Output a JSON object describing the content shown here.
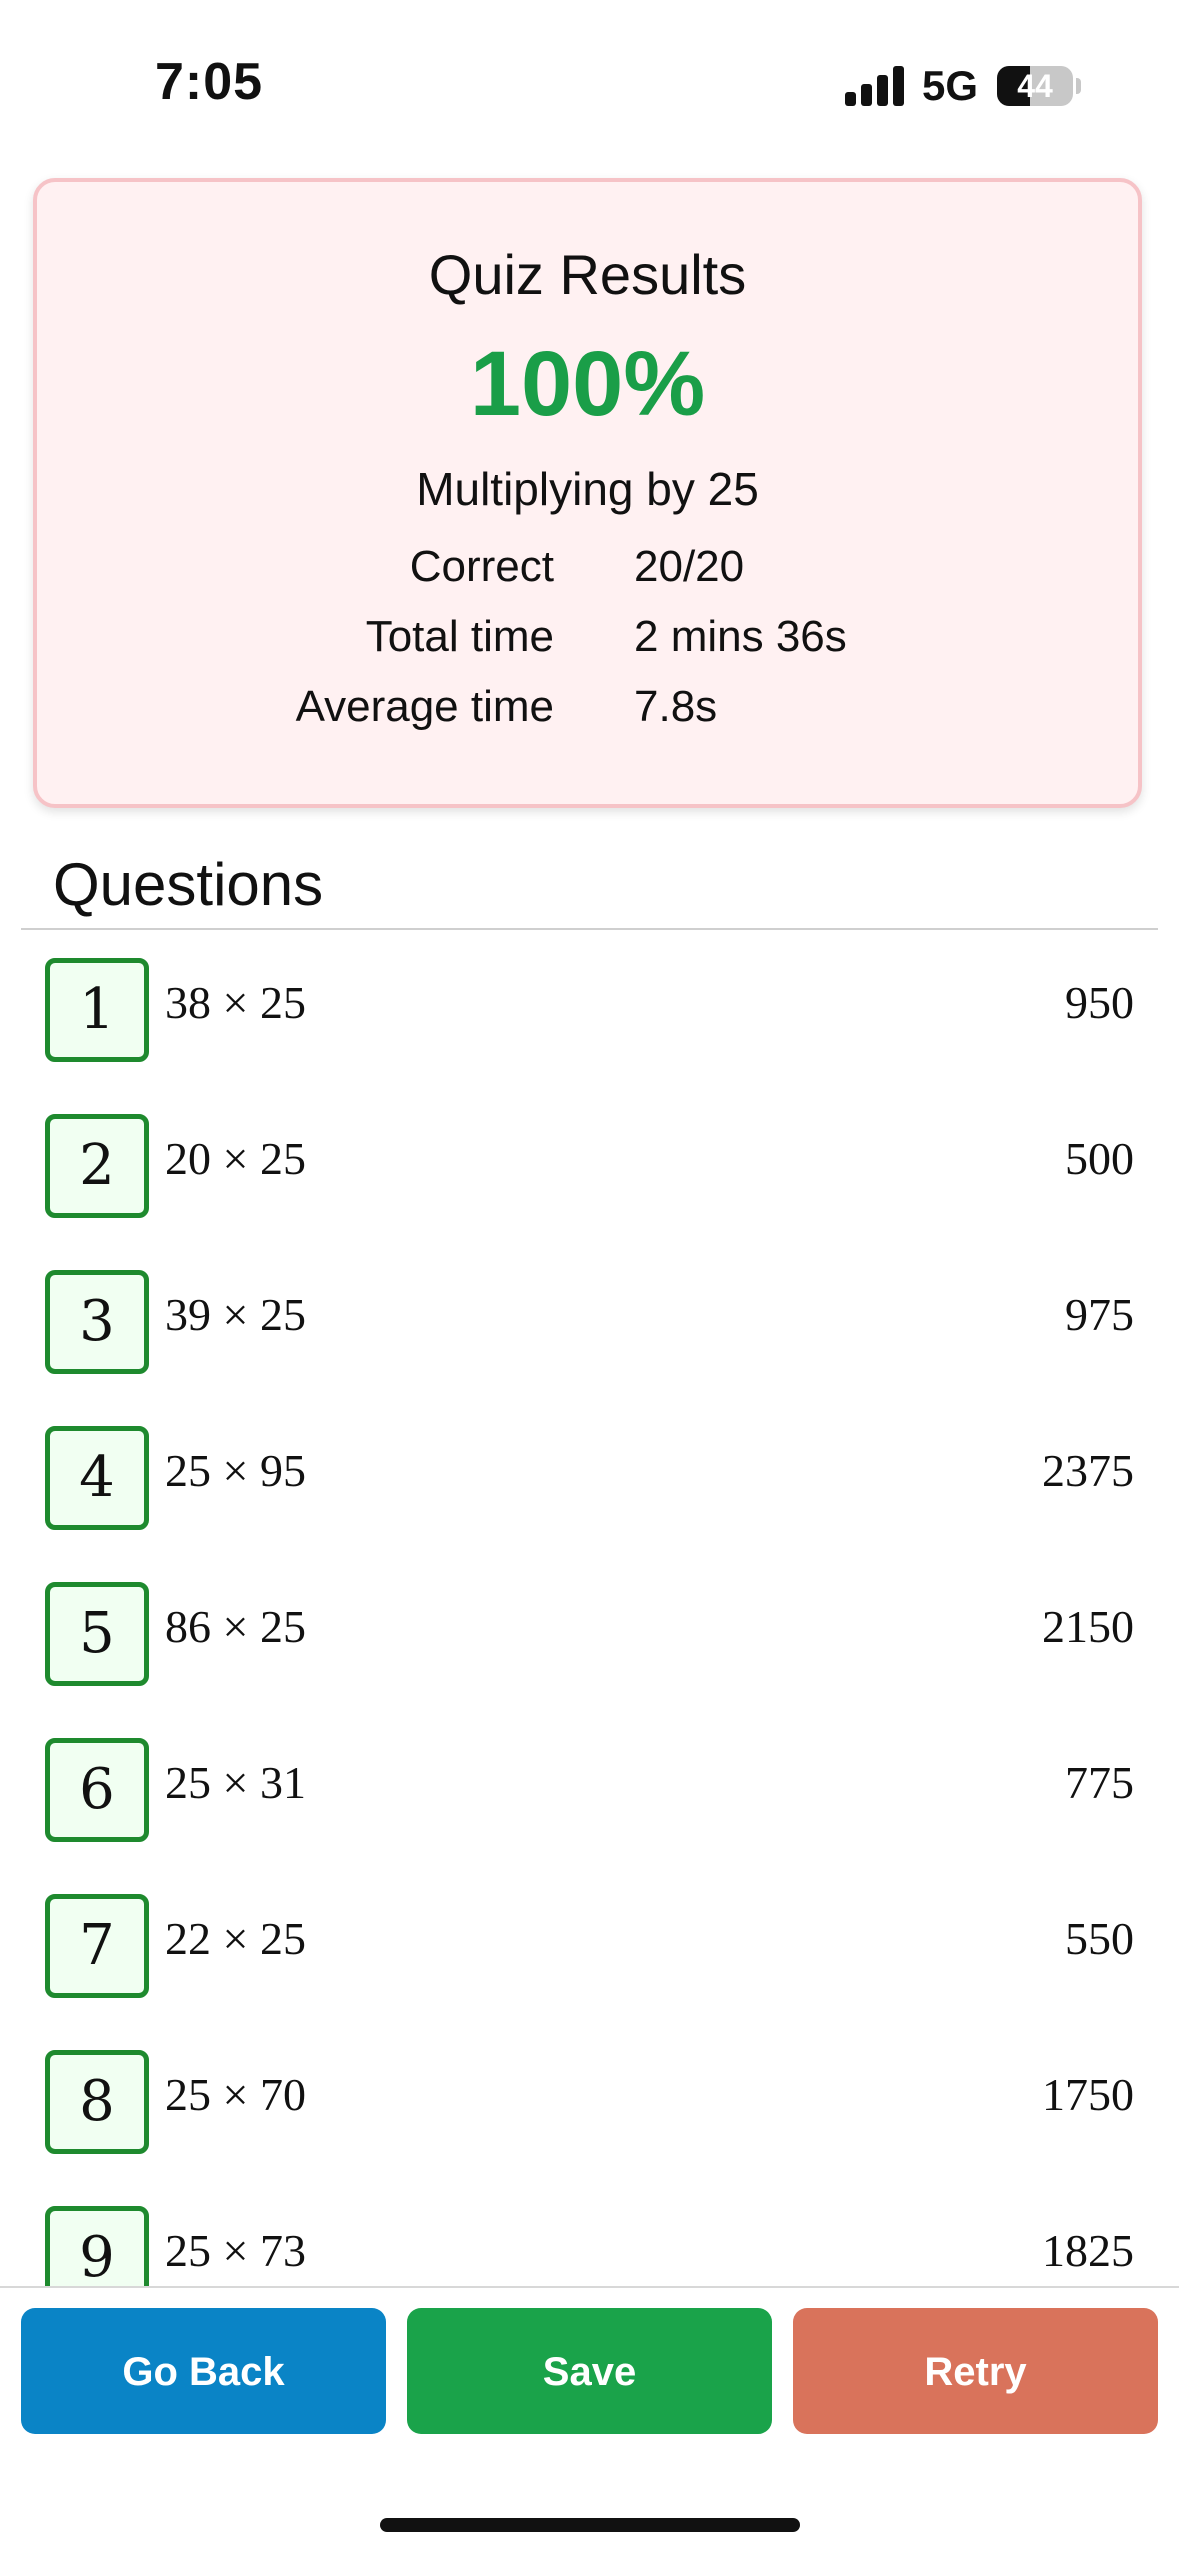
{
  "status_bar": {
    "time": "7:05",
    "network": "5G",
    "battery": {
      "level": 44,
      "label": "44"
    },
    "signal_bars": 4
  },
  "result": {
    "title": "Quiz Results",
    "score": "100%",
    "topic": "Multiplying by 25",
    "stats": [
      {
        "label": "Correct",
        "value": "20/20"
      },
      {
        "label": "Total time",
        "value": "2 mins 36s"
      },
      {
        "label": "Average time",
        "value": "7.8s"
      }
    ]
  },
  "questions": {
    "heading": "Questions",
    "items": [
      {
        "number": "1",
        "expression": "38 × 25",
        "answer": "950"
      },
      {
        "number": "2",
        "expression": "20 × 25",
        "answer": "500"
      },
      {
        "number": "3",
        "expression": "39 × 25",
        "answer": "975"
      },
      {
        "number": "4",
        "expression": "25 × 95",
        "answer": "2375"
      },
      {
        "number": "5",
        "expression": "86 × 25",
        "answer": "2150"
      },
      {
        "number": "6",
        "expression": "25 × 31",
        "answer": "775"
      },
      {
        "number": "7",
        "expression": "22 × 25",
        "answer": "550"
      },
      {
        "number": "8",
        "expression": "25 × 70",
        "answer": "1750"
      },
      {
        "number": "9",
        "expression": "25 × 73",
        "answer": "1825"
      }
    ]
  },
  "actions": {
    "back_label": "Go Back",
    "save_label": "Save",
    "retry_label": "Retry"
  },
  "colors": {
    "score": "#1a9e48",
    "correct_border": "#1e8a2e",
    "back_button": "#0a84c6",
    "save_button": "#1aa34a",
    "retry_button": "#d9735b",
    "card_background": "#fff1f2"
  }
}
